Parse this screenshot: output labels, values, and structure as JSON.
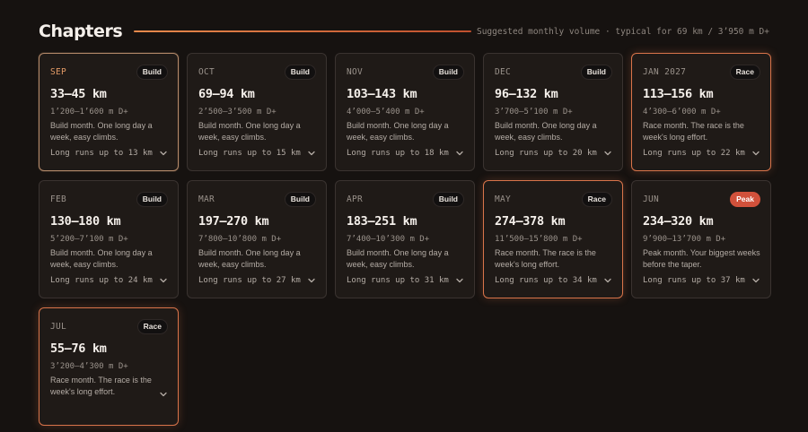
{
  "header": {
    "title": "Chapters",
    "subtitle": "Suggested monthly volume · typical for 69 km / 3’950 m D+",
    "accent_color": "#e78a4c"
  },
  "colors": {
    "background": "#161210",
    "card": "#1f1a17",
    "race_border": "#d9744a",
    "peak_badge": "#d1513b"
  },
  "cards": [
    {
      "month": "SEP",
      "badge": "Build",
      "range": "33–45 km",
      "elev": "1’200–1’600 m D+",
      "desc": "Build month. One long day a week, easy climbs.",
      "longrun": "Long runs up to 13 km",
      "icon": "chevron-down-icon"
    },
    {
      "month": "OCT",
      "badge": "Build",
      "range": "69–94 km",
      "elev": "2’500–3’500 m D+",
      "desc": "Build month. One long day a week, easy climbs.",
      "longrun": "Long runs up to 15 km",
      "icon": "chevron-down-icon"
    },
    {
      "month": "NOV",
      "badge": "Build",
      "range": "103–143 km",
      "elev": "4’000–5’400 m D+",
      "desc": "Build month. One long day a week, easy climbs.",
      "longrun": "Long runs up to 18 km",
      "icon": "chevron-down-icon"
    },
    {
      "month": "DEC",
      "badge": "Build",
      "range": "96–132 km",
      "elev": "3’700–5’100 m D+",
      "desc": "Build month. One long day a week, easy climbs.",
      "longrun": "Long runs up to 20 km",
      "icon": "chevron-down-icon"
    },
    {
      "month": "JAN 2027",
      "badge": "Race",
      "range": "113–156 km",
      "elev": "4’300–6’000 m D+",
      "desc": "Race month. The race is the week's long effort.",
      "longrun": "Long runs up to 22 km",
      "icon": "chevron-down-icon"
    },
    {
      "month": "FEB",
      "badge": "Build",
      "range": "130–180 km",
      "elev": "5’200–7’100 m D+",
      "desc": "Build month. One long day a week, easy climbs.",
      "longrun": "Long runs up to 24 km",
      "icon": "chevron-down-icon"
    },
    {
      "month": "MAR",
      "badge": "Build",
      "range": "197–270 km",
      "elev": "7’800–10’800 m D+",
      "desc": "Build month. One long day a week, easy climbs.",
      "longrun": "Long runs up to 27 km",
      "icon": "chevron-down-icon"
    },
    {
      "month": "APR",
      "badge": "Build",
      "range": "183–251 km",
      "elev": "7’400–10’300 m D+",
      "desc": "Build month. One long day a week, easy climbs.",
      "longrun": "Long runs up to 31 km",
      "icon": "chevron-down-icon"
    },
    {
      "month": "MAY",
      "badge": "Race",
      "range": "274–378 km",
      "elev": "11’500–15’800 m D+",
      "desc": "Race month. The race is the week's long effort.",
      "longrun": "Long runs up to 34 km",
      "icon": "chevron-down-icon"
    },
    {
      "month": "JUN",
      "badge": "Peak",
      "range": "234–320 km",
      "elev": "9’900–13’700 m D+",
      "desc": "Peak month. Your biggest weeks before the taper.",
      "longrun": "Long runs up to 37 km",
      "icon": "chevron-down-icon"
    },
    {
      "month": "JUL",
      "badge": "Race",
      "range": "55–76 km",
      "elev": "3’200–4’300 m D+",
      "desc": "Race month. The race is the week's long effort.",
      "longrun": "",
      "icon": "chevron-down-icon"
    }
  ]
}
